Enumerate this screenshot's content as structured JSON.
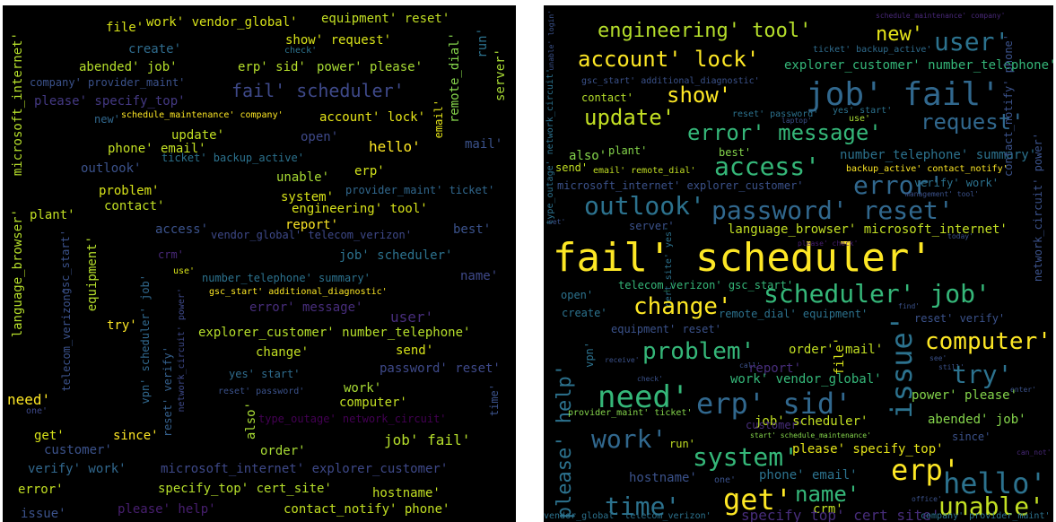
{
  "left_cloud": {
    "words": [
      {
        "t": "work' vendor_global'",
        "c": "#d7e219"
      },
      {
        "t": "file'",
        "c": "#d7e219"
      },
      {
        "t": "equipment' reset'",
        "c": "#c2df23"
      },
      {
        "t": "create'",
        "c": "#2f6c8e"
      },
      {
        "t": "show' request'",
        "c": "#d7e219"
      },
      {
        "t": "run'",
        "c": "#2c728e"
      },
      {
        "t": "abended' job'",
        "c": "#b5de2b"
      },
      {
        "t": "erp' sid'",
        "c": "#b5de2b"
      },
      {
        "t": "power' please'",
        "c": "#a8db34"
      },
      {
        "t": "company' provider_maint'",
        "c": "#3b528b"
      },
      {
        "t": "fail' scheduler'",
        "c": "#3e4989"
      },
      {
        "t": "please' specify_top'",
        "c": "#443983"
      },
      {
        "t": "server'",
        "c": "#a8db34"
      },
      {
        "t": "microsoft_internet'",
        "c": "#b5de2b"
      },
      {
        "t": "remote_dial'",
        "c": "#84d44b"
      },
      {
        "t": "email'",
        "c": "#e5e419"
      },
      {
        "t": "new'",
        "c": "#31688e"
      },
      {
        "t": "schedule_maintenance' company'",
        "c": "#fde725"
      },
      {
        "t": "account' lock'",
        "c": "#e5e419"
      },
      {
        "t": "update'",
        "c": "#c2df23"
      },
      {
        "t": "open'",
        "c": "#3e4989"
      },
      {
        "t": "mail'",
        "c": "#3b528b"
      },
      {
        "t": "phone' email'",
        "c": "#c2df23"
      },
      {
        "t": "hello'",
        "c": "#fde725"
      },
      {
        "t": "outlook'",
        "c": "#3b528b"
      },
      {
        "t": "ticket' backup_active'",
        "c": "#2c728e"
      },
      {
        "t": "erp'",
        "c": "#d2e21b"
      },
      {
        "t": "unable'",
        "c": "#a8db34"
      },
      {
        "t": "problem'",
        "c": "#d7e219"
      },
      {
        "t": "system'",
        "c": "#d7e219"
      },
      {
        "t": "provider_maint' ticket'",
        "c": "#31688e"
      },
      {
        "t": "contact'",
        "c": "#c2df23"
      },
      {
        "t": "engineering' tool'",
        "c": "#d7e219"
      },
      {
        "t": "plant'",
        "c": "#c2df23"
      },
      {
        "t": "report'",
        "c": "#fde725"
      },
      {
        "t": "access'",
        "c": "#3b528b"
      },
      {
        "t": "vendor_global' telecom_verizon'",
        "c": "#3e4989"
      },
      {
        "t": "best'",
        "c": "#3b528b"
      },
      {
        "t": "language_browser'",
        "c": "#b5de2b"
      },
      {
        "t": "gsc_start'",
        "c": "#3b528b"
      },
      {
        "t": "crm'",
        "c": "#482878"
      },
      {
        "t": "job' scheduler'",
        "c": "#2c728e"
      },
      {
        "t": "use'",
        "c": "#d7e219"
      },
      {
        "t": "equipment'",
        "c": "#b5de2b"
      },
      {
        "t": "number_telephone' summary'",
        "c": "#2c728e"
      },
      {
        "t": "name'",
        "c": "#3e4989"
      },
      {
        "t": "gsc_start' additional_diagnostic'",
        "c": "#fde725"
      },
      {
        "t": "error' message'",
        "c": "#472d7b"
      },
      {
        "t": "user'",
        "c": "#472d7b"
      },
      {
        "t": "try'",
        "c": "#fde725"
      },
      {
        "t": "explorer_customer' number_telephone'",
        "c": "#b5de2b"
      },
      {
        "t": "change'",
        "c": "#c2df23"
      },
      {
        "t": "send'",
        "c": "#d7e219"
      },
      {
        "t": "telecom_verizon'",
        "c": "#3b528b"
      },
      {
        "t": "vpn' scheduler' job'",
        "c": "#31688e"
      },
      {
        "t": "yes' start'",
        "c": "#2f6c8e"
      },
      {
        "t": "password' reset'",
        "c": "#3e4989"
      },
      {
        "t": "reset' password'",
        "c": "#3b528b"
      },
      {
        "t": "need'",
        "c": "#fde725"
      },
      {
        "t": "work'",
        "c": "#a8db34"
      },
      {
        "t": "computer'",
        "c": "#c2df23"
      },
      {
        "t": "one'",
        "c": "#3e4989"
      },
      {
        "t": "network_circuit' power'",
        "c": "#3e4989"
      },
      {
        "t": "reset' verify'",
        "c": "#35608d"
      },
      {
        "t": "also'",
        "c": "#a8db34"
      },
      {
        "t": "type_outage' network_circuit'",
        "c": "#440154"
      },
      {
        "t": "time'",
        "c": "#3b528b"
      },
      {
        "t": "get'",
        "c": "#d7e219"
      },
      {
        "t": "since'",
        "c": "#fde725"
      },
      {
        "t": "job' fail'",
        "c": "#b5de2b"
      },
      {
        "t": "customer'",
        "c": "#3b528b"
      },
      {
        "t": "order'",
        "c": "#a8db34"
      },
      {
        "t": "verify' work'",
        "c": "#31688e"
      },
      {
        "t": "microsoft_internet' explorer_customer'",
        "c": "#3e4989"
      },
      {
        "t": "error'",
        "c": "#c2df23"
      },
      {
        "t": "specify_top' cert_site'",
        "c": "#b5de2b"
      },
      {
        "t": "hostname'",
        "c": "#c2df23"
      },
      {
        "t": "issue'",
        "c": "#3b528b"
      },
      {
        "t": "please' help'",
        "c": "#481f70"
      },
      {
        "t": "contact_notify' phone'",
        "c": "#c2df23"
      },
      {
        "t": "check'",
        "c": "#2c728e"
      }
    ]
  },
  "right_cloud": {
    "words": [
      {
        "t": "unable' login'",
        "c": "#3b528b"
      },
      {
        "t": "schedule_maintenance' company'",
        "c": "#482878"
      },
      {
        "t": "engineering' tool'",
        "c": "#b5de2b"
      },
      {
        "t": "new'",
        "c": "#e5e419"
      },
      {
        "t": "user'",
        "c": "#2c728e"
      },
      {
        "t": "ticket' backup_active'",
        "c": "#2f6c8e"
      },
      {
        "t": "account' lock'",
        "c": "#fde725"
      },
      {
        "t": "explorer_customer' number_telephone'",
        "c": "#35b779"
      },
      {
        "t": "gsc_start' additional_diagnostic'",
        "c": "#3b528b"
      },
      {
        "t": "job' fail'",
        "c": "#31688e"
      },
      {
        "t": "show'",
        "c": "#fde725"
      },
      {
        "t": "contact'",
        "c": "#b5de2b"
      },
      {
        "t": "update'",
        "c": "#c2df23"
      },
      {
        "t": "reset' password'",
        "c": "#2c728e"
      },
      {
        "t": "laptop'",
        "c": "#3b528b"
      },
      {
        "t": "yes' start'",
        "c": "#2c728e"
      },
      {
        "t": "use'",
        "c": "#a8db34"
      },
      {
        "t": "request'",
        "c": "#31688e"
      },
      {
        "t": "error' message'",
        "c": "#35b779"
      },
      {
        "t": "also'",
        "c": "#84d44b"
      },
      {
        "t": "plant'",
        "c": "#84d44b"
      },
      {
        "t": "best'",
        "c": "#84d44b"
      },
      {
        "t": "number_telephone' summary'",
        "c": "#2c728e"
      },
      {
        "t": "access'",
        "c": "#35b779"
      },
      {
        "t": "send'",
        "c": "#c2df23"
      },
      {
        "t": "email' remote_dial'",
        "c": "#c2df23"
      },
      {
        "t": "backup_active' contact_notify'",
        "c": "#fde725"
      },
      {
        "t": "microsoft_internet' explorer_customer'",
        "c": "#3b528b"
      },
      {
        "t": "error'",
        "c": "#31688e"
      },
      {
        "t": "verify' work'",
        "c": "#2c728e"
      },
      {
        "t": "management' tool'",
        "c": "#3b528b"
      },
      {
        "t": "outlook'",
        "c": "#2c728e"
      },
      {
        "t": "password' reset'",
        "c": "#31688e"
      },
      {
        "t": "server'",
        "c": "#3b528b"
      },
      {
        "t": "language_browser' microsoft_internet'",
        "c": "#c2df23"
      },
      {
        "t": "today'",
        "c": "#3b528b"
      },
      {
        "t": "set'",
        "c": "#3b528b"
      },
      {
        "t": "fail' scheduler'",
        "c": "#fde725"
      },
      {
        "t": "please' check'",
        "c": "#481f70"
      },
      {
        "t": "cert_site' yes'",
        "c": "#2c728e"
      },
      {
        "t": "telecom_verizon' gsc_start'",
        "c": "#35b779"
      },
      {
        "t": "open'",
        "c": "#2c728e"
      },
      {
        "t": "scheduler' job'",
        "c": "#35b779"
      },
      {
        "t": "change'",
        "c": "#fde725"
      },
      {
        "t": "create'",
        "c": "#2c728e"
      },
      {
        "t": "remote_dial' equipment'",
        "c": "#2c728e"
      },
      {
        "t": "reset' verify'",
        "c": "#3b528b"
      },
      {
        "t": "find'",
        "c": "#3b528b"
      },
      {
        "t": "equipment' reset'",
        "c": "#3b528b"
      },
      {
        "t": "problem'",
        "c": "#35b779"
      },
      {
        "t": "order'",
        "c": "#c2df23"
      },
      {
        "t": "mail'",
        "c": "#c2df23"
      },
      {
        "t": "file'",
        "c": "#d7e219"
      },
      {
        "t": "issue'",
        "c": "#2c728e"
      },
      {
        "t": "computer'",
        "c": "#fde725"
      },
      {
        "t": "vpn'",
        "c": "#2c728e"
      },
      {
        "t": "receive'",
        "c": "#3b528b"
      },
      {
        "t": "call'",
        "c": "#3b528b"
      },
      {
        "t": "report'",
        "c": "#472d7b"
      },
      {
        "t": "still'",
        "c": "#3b528b"
      },
      {
        "t": "see'",
        "c": "#3b528b"
      },
      {
        "t": "try'",
        "c": "#2c728e"
      },
      {
        "t": "check'",
        "c": "#3b528b"
      },
      {
        "t": "work' vendor_global'",
        "c": "#35b779"
      },
      {
        "t": "enter'",
        "c": "#3b528b"
      },
      {
        "t": "please' help'",
        "c": "#2c728e"
      },
      {
        "t": "need'",
        "c": "#35b779"
      },
      {
        "t": "erp' sid'",
        "c": "#31688e"
      },
      {
        "t": "power' please'",
        "c": "#84d44b"
      },
      {
        "t": "provider_maint' ticket'",
        "c": "#84d44b"
      },
      {
        "t": "job' scheduler'",
        "c": "#c2df23"
      },
      {
        "t": "abended' job'",
        "c": "#84d44b"
      },
      {
        "t": "customer'",
        "c": "#472d7b"
      },
      {
        "t": "start' schedule_maintenance'",
        "c": "#84d44b"
      },
      {
        "t": "since'",
        "c": "#3b528b"
      },
      {
        "t": "work'",
        "c": "#31688e"
      },
      {
        "t": "run'",
        "c": "#c2df23"
      },
      {
        "t": "can_not'",
        "c": "#482878"
      },
      {
        "t": "system'",
        "c": "#35b779"
      },
      {
        "t": "please' specify_top'",
        "c": "#e5e419"
      },
      {
        "t": "erp'",
        "c": "#fde725"
      },
      {
        "t": "hello'",
        "c": "#2c728e"
      },
      {
        "t": "hostname'",
        "c": "#3b528b"
      },
      {
        "t": "one'",
        "c": "#3b528b"
      },
      {
        "t": "phone' email'",
        "c": "#2c728e"
      },
      {
        "t": "time'",
        "c": "#2c728e"
      },
      {
        "t": "get'",
        "c": "#fde725"
      },
      {
        "t": "name'",
        "c": "#35b779"
      },
      {
        "t": "crm'",
        "c": "#c2df23"
      },
      {
        "t": "office'",
        "c": "#3b528b"
      },
      {
        "t": "unable'",
        "c": "#c2df23"
      },
      {
        "t": "vendor_global' telecom_verizon'",
        "c": "#2c728e"
      },
      {
        "t": "specify_top' cert_site'",
        "c": "#472d7b"
      },
      {
        "t": "company' provider_maint'",
        "c": "#2c728e"
      },
      {
        "t": "type_outage' network_circuit'",
        "c": "#2c728e"
      },
      {
        "t": "network_circuit' power'",
        "c": "#3b528b"
      },
      {
        "t": "contact_notify' phone'",
        "c": "#3b528b"
      }
    ]
  }
}
